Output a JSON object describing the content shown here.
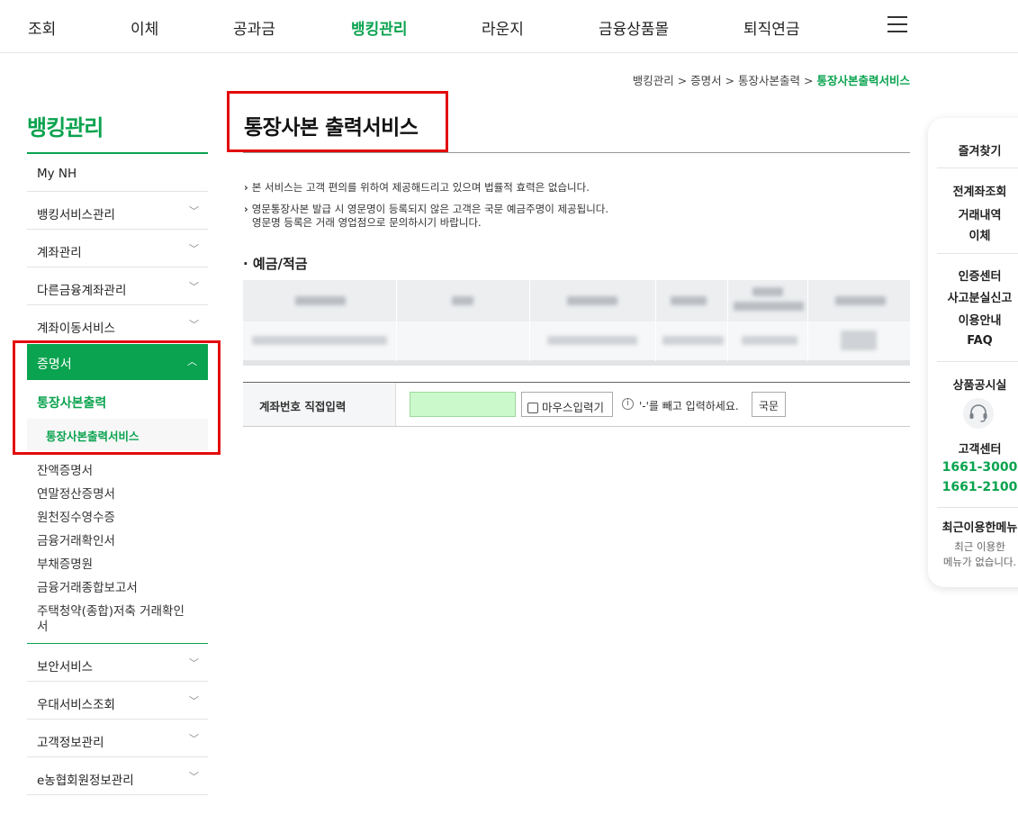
{
  "gnb": {
    "items": [
      "조회",
      "이체",
      "공과금",
      "뱅킹관리",
      "라운지",
      "금융상품몰",
      "퇴직연금"
    ],
    "active": "뱅킹관리",
    "menu_icon": "hamburger-menu-icon"
  },
  "breadcrumb": {
    "path": "뱅킹관리 > 증명서 > 통장사본출력 > ",
    "current": "통장사본출력서비스"
  },
  "lnb": {
    "title": "뱅킹관리",
    "items_top": [
      "My NH",
      "뱅킹서비스관리",
      "계좌관리",
      "다른금융계좌관리",
      "계좌이동서비스"
    ],
    "open_item": "증명서",
    "sub_level1": "통장사본출력",
    "sub_level2": "통장사본출력서비스",
    "links": [
      "잔액증명서",
      "연말정산증명서",
      "원천징수영수증",
      "금융거래확인서",
      "부채증명원",
      "금융거래종합보고서",
      "주택청약(종합)저축 거래확인",
      "서"
    ],
    "items_bottom": [
      "보안서비스",
      "우대서비스조회",
      "고객정보관리",
      "e농협회원정보관리"
    ],
    "chevron_icon": "chevron-down-icon",
    "open_chevron_icon": "chevron-up-icon"
  },
  "content": {
    "title": "통장사본 출력서비스",
    "notices": [
      "본 서비스는 고객 편의를 위하여 제공해드리고 있으며 법률적 효력은 없습니다.",
      "영문통장사본 발급 시 영문명이 등록되지 않은 고객은 국문 예금주명이 제공됩니다.",
      "영문명 등록은 거래 영업점으로 문의하시기 바랍니다."
    ],
    "section_title": "예금/적금",
    "input_row": {
      "label": "계좌번호 직접입력",
      "value": "",
      "mouse_input_label": "마우스입력기",
      "hint": "'-'를 빼고 입력하세요.",
      "lang_button": "국문"
    }
  },
  "quick_menu": {
    "favorites": "즐겨찾기",
    "group1": [
      "전계좌조회",
      "거래내역",
      "이체"
    ],
    "group2": [
      "인증센터",
      "사고분실신고",
      "이용안내",
      "FAQ"
    ],
    "product": "상품공시실",
    "support_label": "고객센터",
    "phones": [
      "1661-3000",
      "1661-2100"
    ],
    "recent_title": "최근이용한메뉴",
    "recent_empty": [
      "최근 이용한",
      "메뉴가 없습니다."
    ],
    "headset_icon": "headset-icon"
  },
  "colors": {
    "brand": "#0aa34f",
    "highlight_box": "#e30b0b",
    "input_bg": "#ccf9cc"
  }
}
